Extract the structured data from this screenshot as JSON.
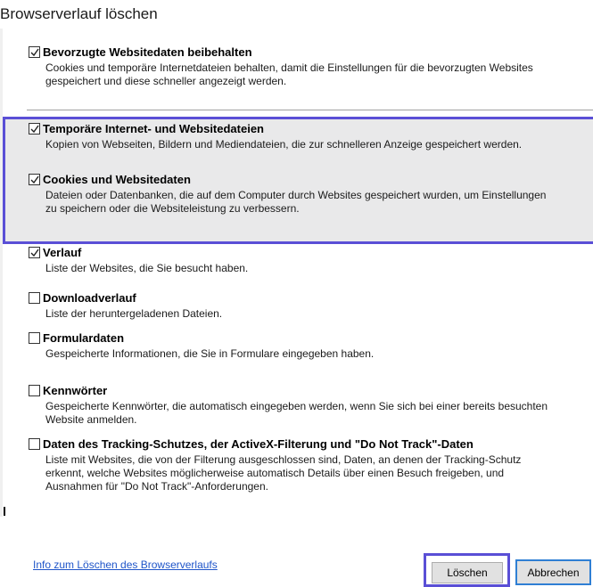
{
  "dialog": {
    "title": "Browserverlauf löschen"
  },
  "options": [
    {
      "id": "favorites",
      "label": "Bevorzugte Websitedaten beibehalten",
      "checked": true,
      "desc_lines": [
        "Cookies und temporäre Internetdateien behalten, damit die Einstellungen für die bevorzugten Websites",
        "gespeichert und diese schneller angezeigt werden."
      ]
    },
    {
      "id": "temp-files",
      "label": "Temporäre Internet- und Websitedateien",
      "checked": true,
      "desc_lines": [
        "Kopien von Webseiten, Bildern und Mediendateien, die zur schnelleren Anzeige gespeichert werden."
      ]
    },
    {
      "id": "cookies",
      "label": "Cookies und Websitedaten",
      "checked": true,
      "desc_lines": [
        "Dateien oder Datenbanken, die auf dem Computer durch Websites gespeichert wurden, um Einstellungen",
        "zu speichern oder die Websiteleistung zu verbessern."
      ]
    },
    {
      "id": "history",
      "label": "Verlauf",
      "checked": true,
      "desc_lines": [
        "Liste der Websites, die Sie besucht haben."
      ]
    },
    {
      "id": "download-history",
      "label": "Downloadverlauf",
      "checked": false,
      "desc_lines": [
        "Liste der heruntergeladenen Dateien."
      ]
    },
    {
      "id": "form-data",
      "label": "Formulardaten",
      "checked": false,
      "desc_lines": [
        "Gespeicherte Informationen, die Sie in Formulare eingegeben haben."
      ]
    },
    {
      "id": "passwords",
      "label": "Kennwörter",
      "checked": false,
      "desc_lines": [
        "Gespeicherte Kennwörter, die automatisch eingegeben werden, wenn Sie sich bei einer bereits besuchten",
        "Website anmelden."
      ]
    },
    {
      "id": "tracking",
      "label": "Daten des Tracking-Schutzes, der ActiveX-Filterung und \"Do Not Track\"-Daten",
      "checked": false,
      "desc_lines": [
        "Liste mit Websites, die von der Filterung ausgeschlossen sind, Daten, an denen der Tracking-Schutz",
        "erkennt, welche Websites möglicherweise automatisch Details über einen Besuch freigeben, und",
        "Ausnahmen für \"Do Not Track\"-Anforderungen."
      ]
    }
  ],
  "footer": {
    "help_link": "Info zum Löschen des Browserverlaufs",
    "delete_button": "Löschen",
    "cancel_button": "Abbrechen"
  },
  "colors": {
    "highlight_border": "#5a4fd6",
    "highlight_bg": "#e9e9ea",
    "link": "#1f55c9",
    "cancel_focus": "#2f7fd4"
  }
}
